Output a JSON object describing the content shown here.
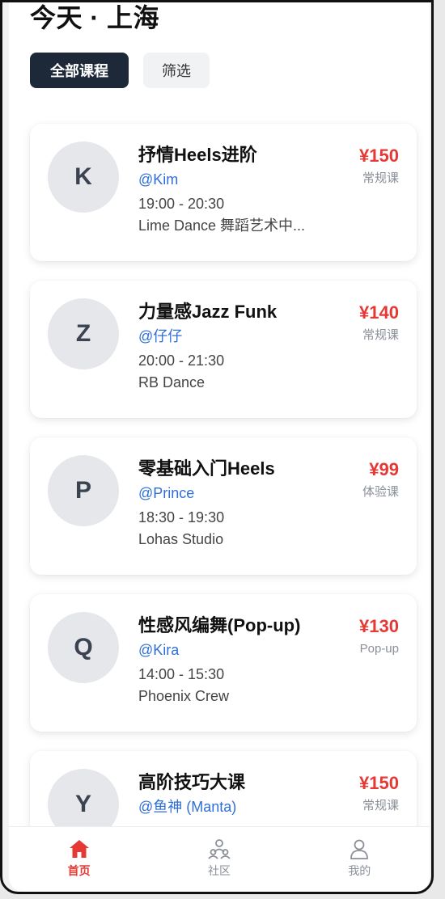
{
  "header": {
    "title": "今天 · 上海",
    "filters": [
      {
        "label": "全部课程",
        "active": true
      },
      {
        "label": "筛选",
        "active": false
      }
    ]
  },
  "courses": [
    {
      "avatar": "K",
      "title": "抒情Heels进阶",
      "teacher": "@Kim",
      "time": "19:00 - 20:30",
      "venue": "Lime Dance 舞蹈艺术中...",
      "price": "¥150",
      "type": "常规课"
    },
    {
      "avatar": "Z",
      "title": "力量感Jazz Funk",
      "teacher": "@仔仔",
      "time": "20:00 - 21:30",
      "venue": "RB Dance",
      "price": "¥140",
      "type": "常规课"
    },
    {
      "avatar": "P",
      "title": "零基础入门Heels",
      "teacher": "@Prince",
      "time": "18:30 - 19:30",
      "venue": "Lohas Studio",
      "price": "¥99",
      "type": "体验课"
    },
    {
      "avatar": "Q",
      "title": "性感风编舞(Pop-up)",
      "teacher": "@Kira",
      "time": "14:00 - 15:30",
      "venue": "Phoenix Crew",
      "price": "¥130",
      "type": "Pop-up"
    },
    {
      "avatar": "Y",
      "title": "高阶技巧大课",
      "teacher": "@鱼神 (Manta)",
      "time": "",
      "venue": "",
      "price": "¥150",
      "type": "常规课"
    }
  ],
  "tabbar": [
    {
      "label": "首页",
      "icon": "home-icon",
      "active": true
    },
    {
      "label": "社区",
      "icon": "community-icon",
      "active": false
    },
    {
      "label": "我的",
      "icon": "profile-icon",
      "active": false
    }
  ],
  "colors": {
    "accent": "#e53935",
    "link": "#2f6fd6",
    "dark": "#1d2939"
  }
}
